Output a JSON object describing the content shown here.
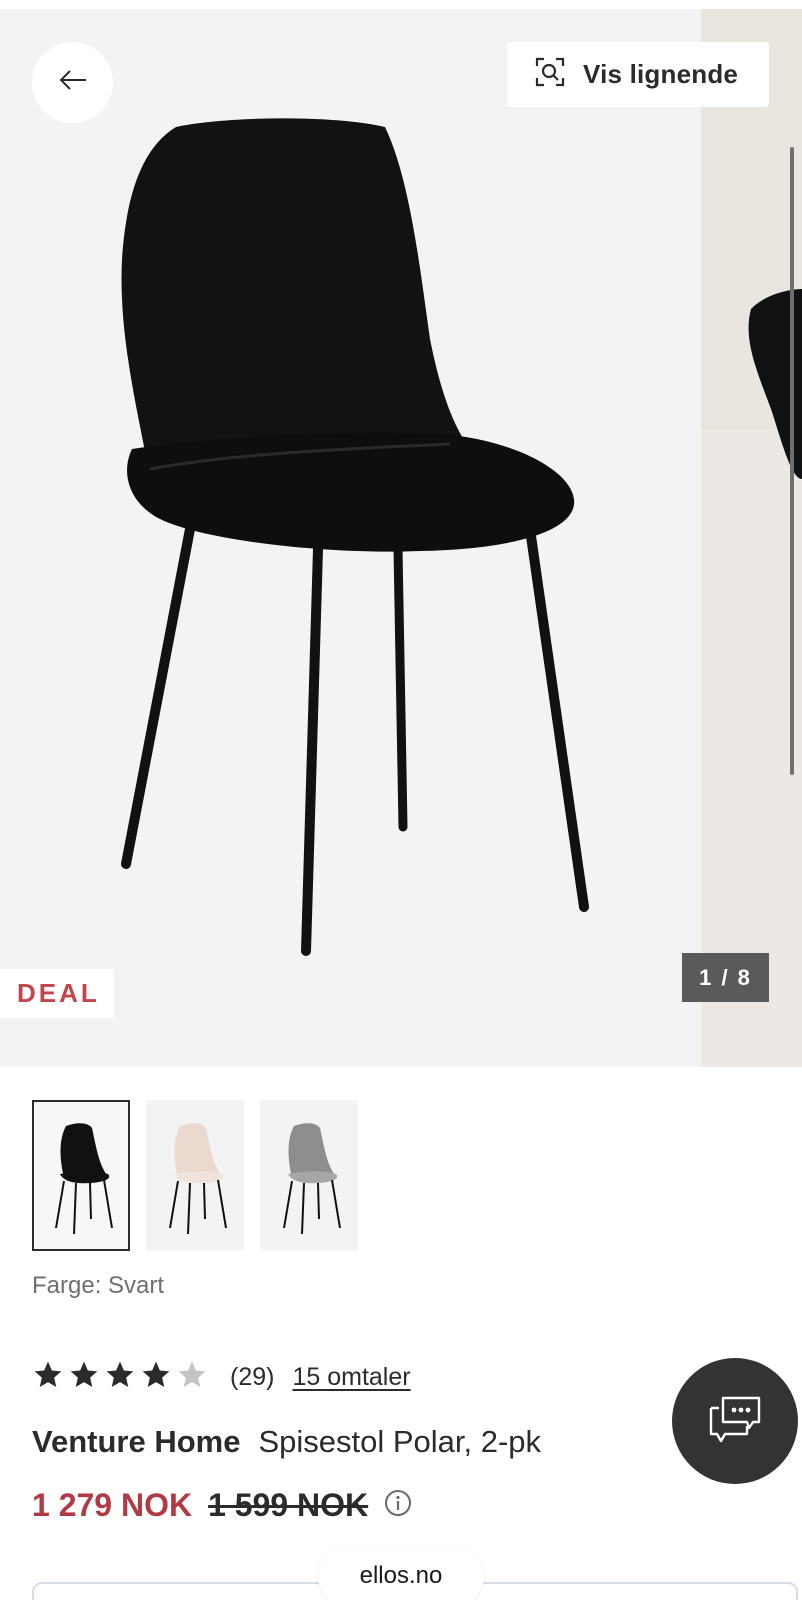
{
  "gallery": {
    "similar_button_label": "Vis lignende",
    "deal_badge": "DEAL",
    "counter": "1 / 8"
  },
  "color": {
    "label": "Farge: Svart",
    "swatches": [
      "Svart",
      "Beige",
      "Grå"
    ]
  },
  "rating": {
    "stars": 4,
    "max": 5,
    "count": "(29)",
    "reviews_link": "15 omtaler"
  },
  "product": {
    "brand": "Venture Home",
    "name": "Spisestol Polar, 2-pk"
  },
  "price": {
    "current": "1 279 NOK",
    "original": "1 599 NOK"
  },
  "browser": {
    "url": "ellos.no"
  },
  "colors": {
    "accent_red": "#b23a45",
    "dark": "#2b2b2b",
    "chat_bg": "#333333"
  }
}
